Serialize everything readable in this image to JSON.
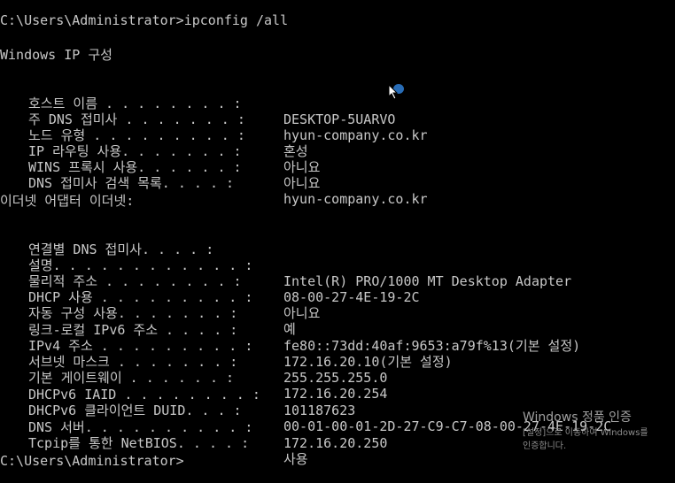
{
  "prompt1": "C:\\Users\\Administrator>ipconfig /all",
  "section_windows": "Windows IP 구성",
  "host": [
    {
      "label": "호스트 이름 . . . . . . . . :",
      "value": "DESKTOP-5UARVO"
    },
    {
      "label": "주 DNS 접미사 . . . . . . . :",
      "value": "hyun-company.co.kr"
    },
    {
      "label": "노드 유형 . . . . . . . . . :",
      "value": "혼성"
    },
    {
      "label": "IP 라우팅 사용. . . . . . . :",
      "value": "아니요"
    },
    {
      "label": "WINS 프록시 사용. . . . . . :",
      "value": "아니요"
    },
    {
      "label": "DNS 접미사 검색 목록. . . . :",
      "value": "hyun-company.co.kr"
    }
  ],
  "section_ethernet": "이더넷 어댑터 이더넷:",
  "adapter": [
    {
      "label": "연결별 DNS 접미사. . . . :",
      "value": ""
    },
    {
      "label": "설명. . . . . . . . . . . . :",
      "value": "Intel(R) PRO/1000 MT Desktop Adapter"
    },
    {
      "label": "물리적 주소 . . . . . . . . :",
      "value": "08-00-27-4E-19-2C"
    },
    {
      "label": "DHCP 사용 . . . . . . . . . :",
      "value": "아니요"
    },
    {
      "label": "자동 구성 사용. . . . . . . :",
      "value": "예"
    },
    {
      "label": "링크-로컬 IPv6 주소 . . . . :",
      "value": "fe80::73dd:40af:9653:a79f%13(기본 설정)"
    },
    {
      "label": "IPv4 주소 . . . . . . . . . :",
      "value": "172.16.20.10(기본 설정)"
    },
    {
      "label": "서브넷 마스크 . . . . . . . :",
      "value": "255.255.255.0"
    },
    {
      "label": "기본 게이트웨이 . . . . . . :",
      "value": "172.16.20.254"
    },
    {
      "label": "DHCPv6 IAID . . . . . . . . :",
      "value": "101187623"
    },
    {
      "label": "DHCPv6 클라이언트 DUID. . . :",
      "value": "00-01-00-01-2D-27-C9-C7-08-00-27-4E-19-2C"
    },
    {
      "label": "DNS 서버. . . . . . . . . . :",
      "value": "172.16.20.250"
    },
    {
      "label": "Tcpip를 통한 NetBIOS. . . . :",
      "value": "사용"
    }
  ],
  "prompt2": "C:\\Users\\Administrator>",
  "activation": {
    "title": "Windows 정품 인증",
    "body_line1": "[설정]으로 이동하여 Windows를",
    "body_line2": "인증합니다."
  },
  "colors": {
    "background": "#000000",
    "text": "#c8c8c8",
    "cursor_highlight": "#2f7fd6"
  }
}
